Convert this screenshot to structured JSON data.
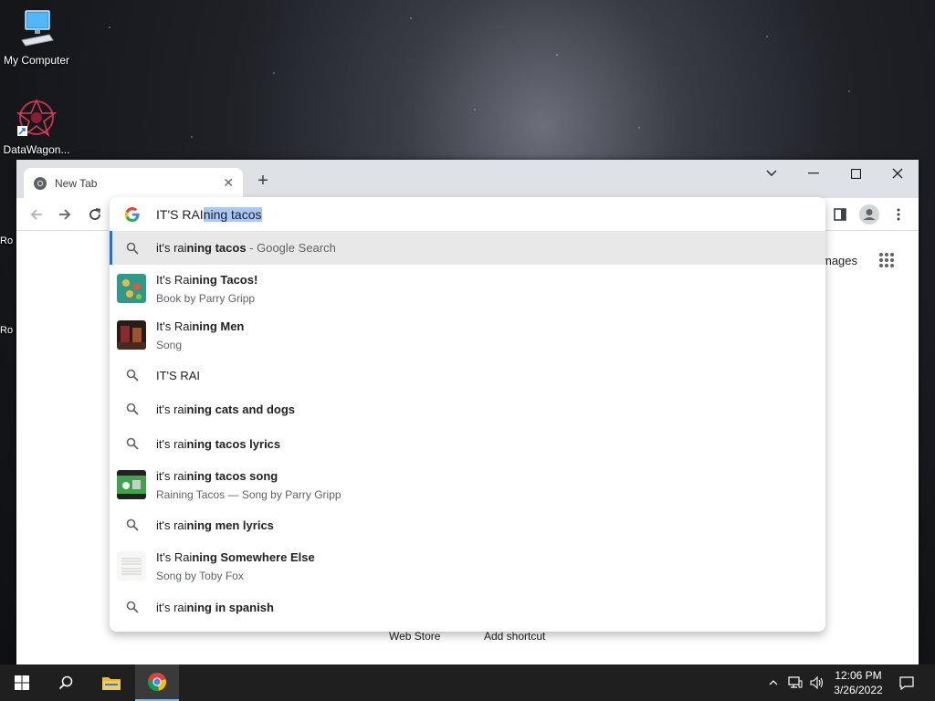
{
  "desktop": {
    "icons": [
      {
        "label": "My Computer",
        "icon": "computer-icon"
      },
      {
        "label": "DataWagon...",
        "icon": "datawagon-icon"
      }
    ],
    "partial_labels": [
      "Ro",
      "Ro"
    ]
  },
  "browser": {
    "tab": {
      "title": "New Tab"
    },
    "omnibox": {
      "typed": "IT'S RAI",
      "autocomplete": "ning tacos"
    },
    "ntp": {
      "images_link": "mages",
      "web_store": "Web Store",
      "add_shortcut": "Add shortcut"
    },
    "suggestions": [
      {
        "type": "search",
        "pre": "it's rai",
        "bold": "ning tacos",
        "suffix": " - Google Search",
        "sub": ""
      },
      {
        "type": "entity",
        "pre": "It's Rai",
        "bold": "ning Tacos!",
        "suffix": "",
        "sub": "Book by Parry Gripp",
        "thumb": "book-cover"
      },
      {
        "type": "entity",
        "pre": "It's Rai",
        "bold": "ning Men",
        "suffix": "",
        "sub": "Song",
        "thumb": "song-cover"
      },
      {
        "type": "search",
        "pre": "IT'S RAI",
        "bold": "",
        "suffix": "",
        "sub": ""
      },
      {
        "type": "search",
        "pre": "it's rai",
        "bold": "ning cats and dogs",
        "suffix": "",
        "sub": ""
      },
      {
        "type": "search",
        "pre": "it's rai",
        "bold": "ning tacos lyrics",
        "suffix": "",
        "sub": ""
      },
      {
        "type": "entity",
        "pre": "it's rai",
        "bold": "ning tacos song",
        "suffix": "",
        "sub": "Raining Tacos — Song by Parry Gripp",
        "thumb": "video-thumb"
      },
      {
        "type": "search",
        "pre": "it's rai",
        "bold": "ning men lyrics",
        "suffix": "",
        "sub": ""
      },
      {
        "type": "entity",
        "pre": "It's Rai",
        "bold": "ning Somewhere Else",
        "suffix": "",
        "sub": "Song by Toby Fox",
        "thumb": "sheet-music"
      },
      {
        "type": "search",
        "pre": "it's rai",
        "bold": "ning in spanish",
        "suffix": "",
        "sub": ""
      }
    ]
  },
  "taskbar": {
    "time": "12:06 PM",
    "date": "3/26/2022",
    "items": [
      "start-icon",
      "search-icon",
      "file-explorer-icon",
      "chrome-icon"
    ]
  },
  "colors": {
    "accent": "#1a73e8",
    "selection": "#a8c7fa",
    "taskbar": "#1f1f1f"
  }
}
